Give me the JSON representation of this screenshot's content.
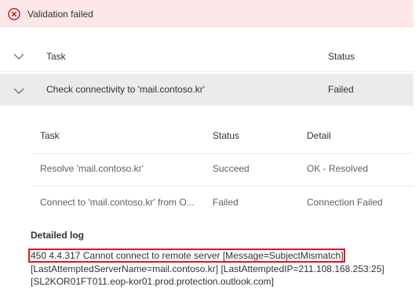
{
  "banner": {
    "message": "Validation failed",
    "icon": "error-circle-icon",
    "color": "#fde7e9"
  },
  "table": {
    "col_task": "Task",
    "col_status": "Status",
    "rows": [
      {
        "task": "Check connectivity to 'mail.contoso.kr'",
        "status": "Failed",
        "expanded": true
      }
    ]
  },
  "subtable": {
    "col_task": "Task",
    "col_status": "Status",
    "col_detail": "Detail",
    "rows": [
      {
        "task": "Resolve 'mail.contoso.kr'",
        "status": "Succeed",
        "detail": "OK - Resolved"
      },
      {
        "task": "Connect to 'mail.contoso.kr' from O...",
        "status": "Failed",
        "detail": "Connection Failed"
      }
    ]
  },
  "log": {
    "title": "Detailed log",
    "lines": [
      "450 4.4.317 Cannot connect to remote server [Message=SubjectMismatch]",
      "[LastAttemptedServerName=mail.contoso.kr] [LastAttemptedIP=211.108.168.253:25]",
      "[SL2KOR01FT011.eop-kor01.prod.protection.outlook.com]"
    ],
    "highlight_color": "#e81123"
  }
}
